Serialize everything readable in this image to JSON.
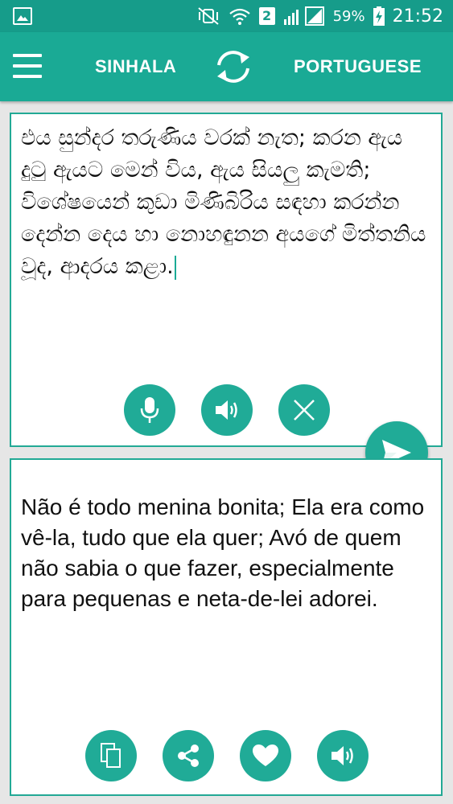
{
  "status_bar": {
    "battery_percent": "59%",
    "time": "21:52",
    "sim_slot": "2",
    "icons": [
      "gallery-icon",
      "mute-vibrate-icon",
      "wifi-icon",
      "signal-icon",
      "battery-charging-icon"
    ]
  },
  "app_bar": {
    "menu_icon": "hamburger-icon",
    "source_language": "SINHALA",
    "target_language": "PORTUGUESE",
    "swap_icon": "swap-arrows-icon"
  },
  "input_panel": {
    "text": "එය සුන්දර තරුණිය වරක් නැත; කරන ඇය දුටු ඇයට මෙන් විය, ඇය සියලු කැමති; විශේෂයෙන් කුඩා මිණිබිරිය සඳහා කරන්න දෙන්න දෙය හා නොහඳුනන අයගේ මිත්තනිය වූද, ආදරය කළා.",
    "buttons": [
      "microphone-icon",
      "speaker-icon",
      "clear-icon"
    ]
  },
  "send_button": {
    "icon": "send-icon"
  },
  "output_panel": {
    "text": "Não é todo menina bonita; Ela era como vê-la, tudo que ela quer; Avó de quem não sabia o que fazer, especialmente para pequenas e neta-de-lei adorei.",
    "buttons": [
      "copy-icon",
      "share-icon",
      "favorite-icon",
      "speaker-icon"
    ]
  },
  "colors": {
    "status_bar": "#169c8a",
    "app_bar": "#1aaa95",
    "accent": "#20ab97",
    "panel_border": "#22a995",
    "background": "#e6e6e6"
  }
}
